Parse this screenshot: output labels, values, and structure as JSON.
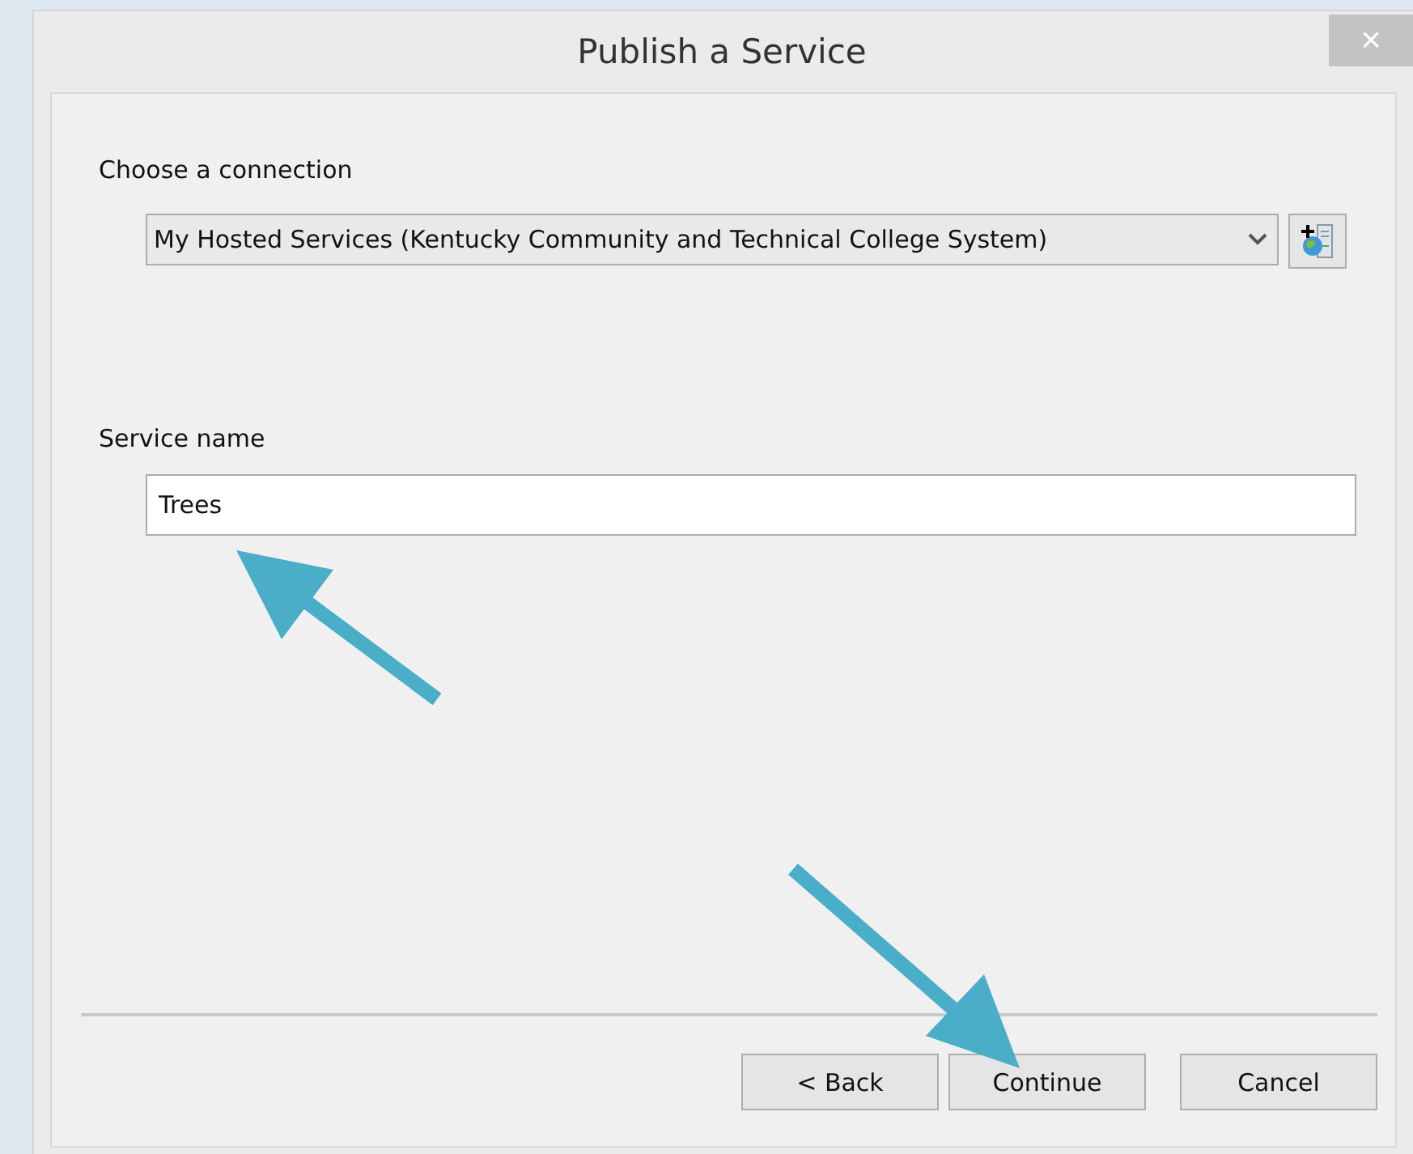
{
  "window": {
    "title": "Publish a Service",
    "close": "×"
  },
  "connection": {
    "label": "Choose a connection",
    "value": "My Hosted Services (Kentucky Community and Technical College System)"
  },
  "service_name": {
    "label": "Service name",
    "value": "Trees"
  },
  "buttons": [
    {
      "label": "< Back"
    },
    {
      "label": "Continue"
    },
    {
      "label": "Cancel"
    }
  ]
}
